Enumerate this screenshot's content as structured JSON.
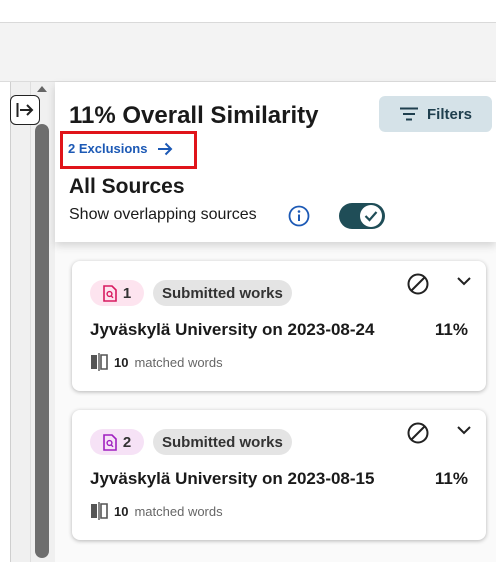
{
  "header": {
    "title": "11% Overall Similarity",
    "filters_label": "Filters",
    "exclusions_label": "2 Exclusions",
    "section_title": "All Sources",
    "overlap_label": "Show overlapping sources",
    "overlap_enabled": true
  },
  "sources": [
    {
      "rank": "1",
      "type": "Submitted works",
      "name": "Jyväskylä University on 2023-08-24",
      "percent": "11%",
      "matched_count": "10",
      "matched_label": "matched words"
    },
    {
      "rank": "2",
      "type": "Submitted works",
      "name": "Jyväskylä University on 2023-08-15",
      "percent": "11%",
      "matched_count": "10",
      "matched_label": "matched words"
    }
  ],
  "colors": {
    "toggle": "#1f4d57",
    "filters_bg": "#d5e2e8",
    "link": "#1c59b5",
    "highlight_box": "#e0141a",
    "badge1_icon": "#d81b60",
    "badge2_icon": "#a020c0"
  }
}
